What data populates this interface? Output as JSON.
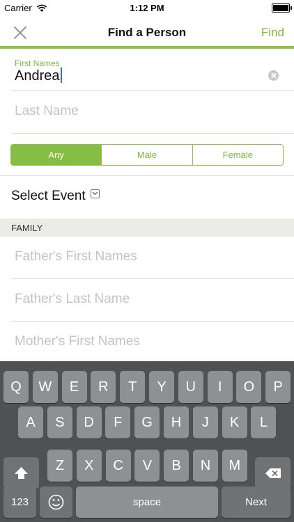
{
  "status_bar": {
    "carrier": "Carrier",
    "time": "1:12 PM",
    "battery_level": 1.0
  },
  "nav": {
    "title": "Find a Person",
    "find_label": "Find",
    "close_icon": "close-icon"
  },
  "form": {
    "first_names": {
      "label": "First Names",
      "value": "Andrea"
    },
    "last_name": {
      "placeholder": "Last Name"
    },
    "gender": {
      "options": [
        "Any",
        "Male",
        "Female"
      ],
      "selected": "Any"
    },
    "select_event_label": "Select Event",
    "family_header": "FAMILY",
    "fathers_first_names": {
      "placeholder": "Father's First Names"
    },
    "fathers_last_name": {
      "placeholder": "Father's Last Name"
    },
    "mothers_first_names": {
      "placeholder": "Mother's First Names"
    }
  },
  "keyboard": {
    "row1": [
      "Q",
      "W",
      "E",
      "R",
      "T",
      "Y",
      "U",
      "I",
      "O",
      "P"
    ],
    "row2": [
      "A",
      "S",
      "D",
      "F",
      "G",
      "H",
      "J",
      "K",
      "L"
    ],
    "row3": [
      "Z",
      "X",
      "C",
      "V",
      "B",
      "N",
      "M"
    ],
    "numbers_label": "123",
    "space_label": "space",
    "next_label": "Next"
  },
  "colors": {
    "accent": "#7cba3d",
    "accent_bar": "#8cc04b",
    "keyboard_bg": "#4f5152",
    "key": "#8e9092"
  }
}
